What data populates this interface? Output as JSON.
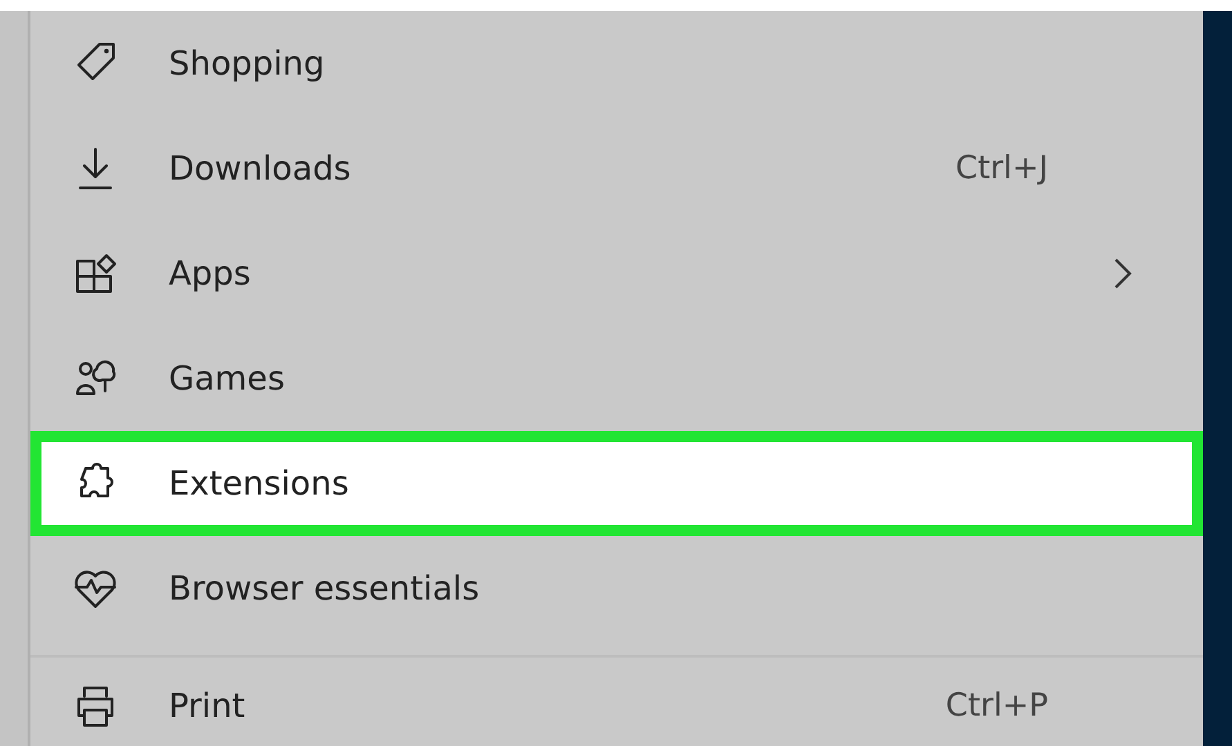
{
  "menu": {
    "sections": [
      {
        "items": [
          {
            "label": "Shopping",
            "selected": false
          },
          {
            "label": "Downloads",
            "shortcut": "Ctrl+J",
            "selected": false
          },
          {
            "label": "Apps",
            "submenu": true,
            "selected": false
          },
          {
            "label": "Games",
            "selected": false
          },
          {
            "label": "Extensions",
            "selected": true
          },
          {
            "label": "Browser essentials",
            "selected": false
          }
        ]
      },
      {
        "items": [
          {
            "label": "Print",
            "shortcut": "Ctrl+P",
            "selected": false
          }
        ]
      }
    ]
  }
}
